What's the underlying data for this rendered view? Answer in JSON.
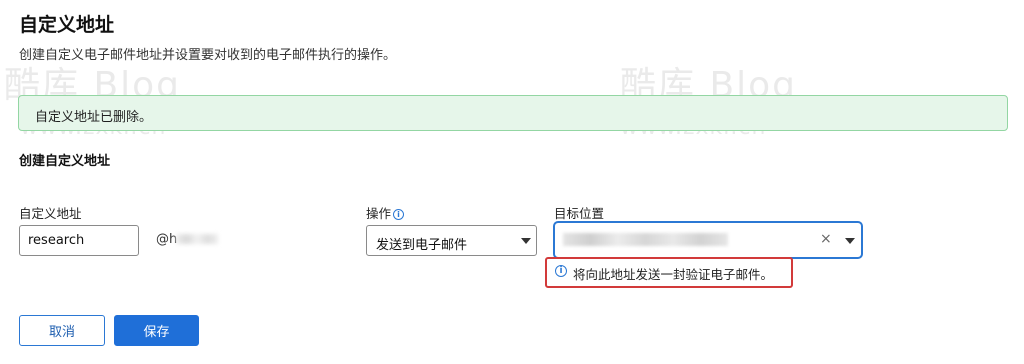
{
  "page": {
    "title": "自定义地址",
    "subtitle": "创建自定义电子邮件地址并设置要对收到的电子邮件执行的操作。"
  },
  "watermark": {
    "brand": "酷库 Blog",
    "url": "www.zxki.cn"
  },
  "banner": {
    "message": "自定义地址已删除。",
    "color": "#e6f6ea",
    "border_color": "#93d6a3"
  },
  "form": {
    "section_title": "创建自定义地址",
    "custom_address": {
      "label": "自定义地址",
      "value": "research"
    },
    "domain_prefix": "@h",
    "action": {
      "label": "操作",
      "info_icon": "info-icon",
      "selected": "发送到电子邮件"
    },
    "target": {
      "label": "目标位置",
      "clear_symbol": "×",
      "hint": "将向此地址发送一封验证电子邮件。",
      "hint_icon": "info-icon"
    }
  },
  "buttons": {
    "cancel": "取消",
    "save": "保存"
  },
  "colors": {
    "accent": "#1f6fd8",
    "highlight": "#d23a3a"
  }
}
